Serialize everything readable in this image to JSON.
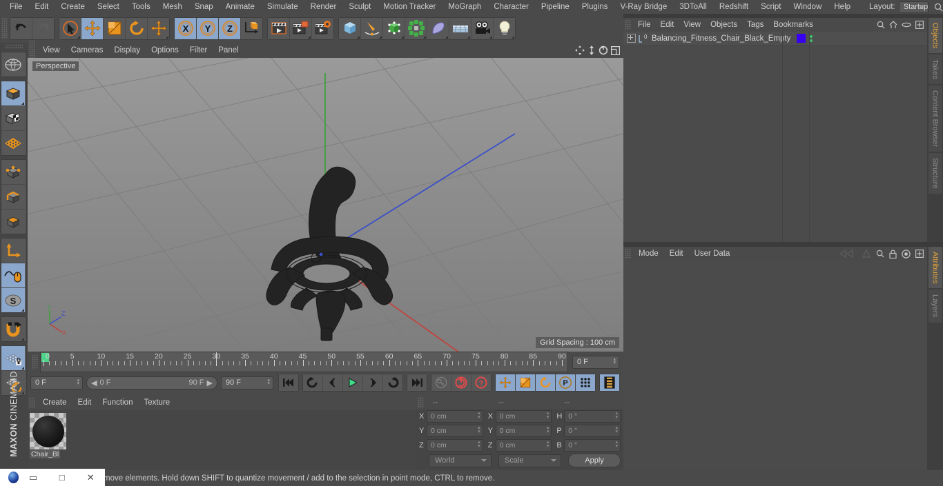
{
  "menubar": {
    "items": [
      "File",
      "Edit",
      "Create",
      "Select",
      "Tools",
      "Mesh",
      "Snap",
      "Animate",
      "Simulate",
      "Render",
      "Sculpt",
      "Motion Tracker",
      "MoGraph",
      "Character",
      "Pipeline",
      "Plugins",
      "V-Ray Bridge",
      "3DToAll",
      "Redshift",
      "Script",
      "Window",
      "Help"
    ],
    "layout_label": "Layout:",
    "layout_value": "Startup"
  },
  "toolbar": {
    "buttons": [
      {
        "name": "undo",
        "icon": "undo-icon",
        "active": false
      },
      {
        "name": "redo",
        "icon": "redo-icon",
        "active": false
      },
      {
        "name": "live-selection",
        "icon": "live-selection-icon",
        "active": false
      },
      {
        "name": "move",
        "icon": "move-icon",
        "active": true
      },
      {
        "name": "scale",
        "icon": "scale-icon",
        "active": false
      },
      {
        "name": "rotate",
        "icon": "rotate-icon",
        "active": false
      },
      {
        "name": "move-duplicate",
        "icon": "move-icon",
        "active": false
      },
      {
        "name": "lock-x",
        "icon": "axis-x-icon",
        "active": true,
        "label": "X"
      },
      {
        "name": "lock-y",
        "icon": "axis-y-icon",
        "active": true,
        "label": "Y"
      },
      {
        "name": "lock-z",
        "icon": "axis-z-icon",
        "active": true,
        "label": "Z"
      },
      {
        "name": "coordinate-system",
        "icon": "world-object-axis-icon",
        "active": false
      },
      {
        "name": "render-view",
        "icon": "render-view-icon",
        "active": false
      },
      {
        "name": "render-to-picture-viewer",
        "icon": "render-picture-viewer-icon",
        "active": false
      },
      {
        "name": "render-settings",
        "icon": "render-settings-icon",
        "active": false
      },
      {
        "name": "add-cube",
        "icon": "cube-icon",
        "active": false
      },
      {
        "name": "add-spline",
        "icon": "pen-spline-icon",
        "active": false
      },
      {
        "name": "add-generator",
        "icon": "generator-icon",
        "active": false
      },
      {
        "name": "add-mograph",
        "icon": "mograph-icon",
        "active": false
      },
      {
        "name": "add-deformer",
        "icon": "deformer-icon",
        "active": false
      },
      {
        "name": "add-environment",
        "icon": "environment-floor-icon",
        "active": false
      },
      {
        "name": "add-camera",
        "icon": "camera-icon",
        "active": false
      },
      {
        "name": "add-light",
        "icon": "light-bulb-icon",
        "active": false
      }
    ]
  },
  "left_toolbar": {
    "buttons": [
      {
        "name": "uv-mode",
        "icon": "uv-globe-icon",
        "active": false
      },
      {
        "name": "model-mode",
        "icon": "model-cube-icon",
        "active": true
      },
      {
        "name": "texture-mode",
        "icon": "texture-cube-icon",
        "active": false
      },
      {
        "name": "workplane-mode",
        "icon": "workplane-grid-icon",
        "active": false
      },
      {
        "name": "points-mode",
        "icon": "points-cube-icon",
        "active": false
      },
      {
        "name": "edges-mode",
        "icon": "edges-cube-icon",
        "active": false
      },
      {
        "name": "polygons-mode",
        "icon": "polygons-cube-icon",
        "active": false
      },
      {
        "name": "axis-modify",
        "icon": "axis-l-icon",
        "active": false
      },
      {
        "name": "enable-snapping",
        "icon": "snap-mouse-icon",
        "active": true
      },
      {
        "name": "soft-selection",
        "icon": "soft-selection-s-icon",
        "active": true
      },
      {
        "name": "magnet-tool",
        "icon": "magnet-icon",
        "active": false
      },
      {
        "name": "workplane-lock",
        "icon": "workplane-lock-icon",
        "active": true
      },
      {
        "name": "workplane-rotate",
        "icon": "workplane-rotate-icon",
        "active": false
      }
    ],
    "brand_bold": "MAXON",
    "brand_light": "CINEMA 4D"
  },
  "viewport": {
    "menu": [
      "View",
      "Cameras",
      "Display",
      "Options",
      "Filter",
      "Panel"
    ],
    "label": "Perspective",
    "grid_spacing": "Grid Spacing : 100 cm",
    "axis_labels": {
      "x": "X",
      "y": "Y",
      "z": "Z"
    },
    "controls": [
      "pan-icon",
      "zoom-icon",
      "rotate-icon",
      "maximize-icon"
    ]
  },
  "timeline": {
    "start_tick": 0,
    "end_tick": 90,
    "tick_step": 5,
    "labels": [
      "0",
      "5",
      "10",
      "15",
      "20",
      "25",
      "30",
      "35",
      "40",
      "45",
      "50",
      "55",
      "60",
      "65",
      "70",
      "75",
      "80",
      "85",
      "90"
    ],
    "current_frame_field": "0 F",
    "preview_min": "0 F",
    "preview_max": "90 F",
    "frame_start": "0 F",
    "frame_end": "90 F",
    "transport": [
      {
        "name": "go-to-start",
        "icon": "skip-start-icon"
      },
      {
        "name": "play-backwards-loop",
        "icon": "loop-back-icon"
      },
      {
        "name": "step-back",
        "icon": "step-back-icon"
      },
      {
        "name": "play-forward",
        "icon": "play-icon",
        "accent": "#3fdd88"
      },
      {
        "name": "step-forward",
        "icon": "step-forward-icon"
      },
      {
        "name": "loop-forward",
        "icon": "loop-forward-icon"
      },
      {
        "name": "go-to-end",
        "icon": "skip-end-icon"
      }
    ],
    "record_group": [
      {
        "name": "autokeying",
        "icon": "key-icon",
        "dim": true
      },
      {
        "name": "record-active-objects",
        "icon": "record-icon",
        "accent": "#e04a4a"
      },
      {
        "name": "keyframe-selection",
        "icon": "question-icon",
        "accent": "#e04a4a"
      }
    ],
    "key_group": [
      {
        "name": "key-position",
        "icon": "move-icon",
        "active": true
      },
      {
        "name": "key-scale",
        "icon": "scale-icon",
        "active": true
      },
      {
        "name": "key-rotation",
        "icon": "rotate-icon",
        "active": true
      },
      {
        "name": "key-parameter",
        "icon": "parameter-p-icon",
        "active": true
      },
      {
        "name": "key-point-level-animation",
        "icon": "dot-grid-icon",
        "active": false
      }
    ],
    "dope_sheet": {
      "name": "timeline-toggle",
      "icon": "film-strip-icon",
      "active": true
    }
  },
  "material_manager": {
    "menu": [
      "Create",
      "Edit",
      "Function",
      "Texture"
    ],
    "materials": [
      {
        "name": "Chair_Bl",
        "color": "#111111"
      }
    ]
  },
  "coordinates": {
    "headers": [
      "--",
      "--",
      "--"
    ],
    "rows": [
      {
        "pos_label": "X",
        "pos_value": "0 cm",
        "size_label": "X",
        "size_value": "0 cm",
        "rot_label": "H",
        "rot_value": "0 °"
      },
      {
        "pos_label": "Y",
        "pos_value": "0 cm",
        "size_label": "Y",
        "size_value": "0 cm",
        "rot_label": "P",
        "rot_value": "0 °"
      },
      {
        "pos_label": "Z",
        "pos_value": "0 cm",
        "size_label": "Z",
        "size_value": "0 cm",
        "rot_label": "B",
        "rot_value": "0 °"
      }
    ],
    "system": "World",
    "mode": "Scale",
    "apply_label": "Apply"
  },
  "object_manager": {
    "menu": [
      "File",
      "Edit",
      "View",
      "Objects",
      "Tags",
      "Bookmarks"
    ],
    "icons": [
      "search-icon",
      "home-icon",
      "ellipse-icon",
      "plus-box-icon"
    ],
    "objects": [
      {
        "name": "Balancing_Fitness_Chair_Black_Empty",
        "layer_digit": "0",
        "color": "#3800f0"
      }
    ]
  },
  "attribute_manager": {
    "menu": [
      "Mode",
      "Edit",
      "User Data"
    ],
    "icons": [
      "nav-back-icon",
      "cone-icon",
      "search-icon",
      "lock-icon",
      "target-icon",
      "plus-box-icon"
    ]
  },
  "right_tabs": {
    "upper": [
      {
        "label": "Objects",
        "active": true
      },
      {
        "label": "Takes",
        "active": false
      },
      {
        "label": "Content Browser",
        "active": false
      },
      {
        "label": "Structure",
        "active": false
      }
    ],
    "lower": [
      {
        "label": "Attributes",
        "active": true
      },
      {
        "label": "Layers",
        "active": false
      }
    ]
  },
  "statusbar": {
    "text": "move elements. Hold down SHIFT to quantize movement / add to the selection in point mode, CTRL to remove."
  },
  "window_controls": {
    "minimize": "▭",
    "maximize": "□",
    "close": "✕"
  },
  "colors": {
    "accent_orange": "#e8a33d",
    "active_blue": "#8ba7cc",
    "axis_x": "#c94b4b",
    "axis_y": "#4fb34f",
    "axis_z": "#4a64d8",
    "playhead_green": "#4fd48a"
  }
}
